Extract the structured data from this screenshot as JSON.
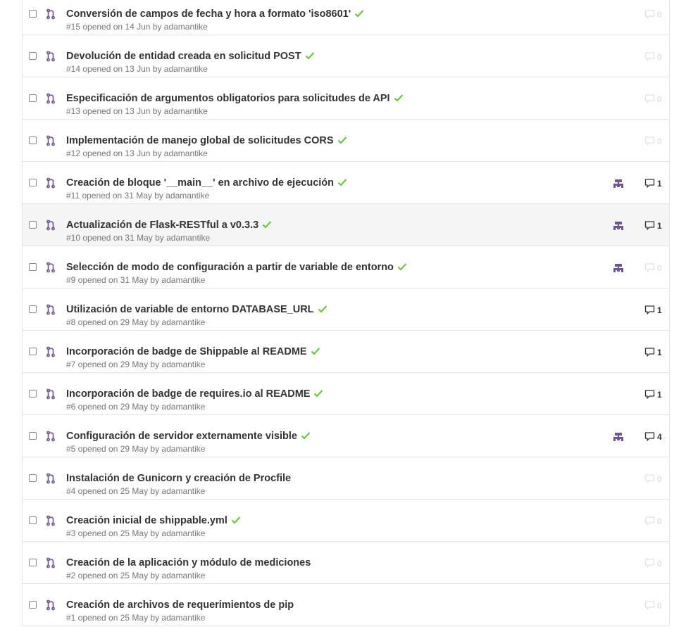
{
  "colors": {
    "pr_icon": "#6e5494",
    "check": "#6cc644",
    "milestone": "#6e5494",
    "comment_active": "#333333",
    "comment_zero": "#e2e2e2",
    "title": "#333333",
    "meta": "#767676"
  },
  "icons": {
    "pr": "git-pull-request-icon",
    "check": "check-icon",
    "milestone": "milestone-icon",
    "comment": "comment-icon"
  },
  "pull_requests": [
    {
      "title": "Conversión de campos de fecha y hora a formato 'iso8601'",
      "meta": "#15 opened on 14 Jun by adamantike",
      "check": true,
      "milestone": false,
      "comments": "0"
    },
    {
      "title": "Devolución de entidad creada en solicitud POST",
      "meta": "#14 opened on 13 Jun by adamantike",
      "check": true,
      "milestone": false,
      "comments": "0"
    },
    {
      "title": "Especificación de argumentos obligatorios para solicitudes de API",
      "meta": "#13 opened on 13 Jun by adamantike",
      "check": true,
      "milestone": false,
      "comments": "0"
    },
    {
      "title": "Implementación de manejo global de solicitudes CORS",
      "meta": "#12 opened on 13 Jun by adamantike",
      "check": true,
      "milestone": false,
      "comments": "0"
    },
    {
      "title": "Creación de bloque '__main__' en archivo de ejecución",
      "meta": "#11 opened on 31 May by adamantike",
      "check": true,
      "milestone": true,
      "comments": "1"
    },
    {
      "title": "Actualización de Flask-RESTful a v0.3.3",
      "meta": "#10 opened on 31 May by adamantike",
      "check": true,
      "milestone": true,
      "comments": "1",
      "highlight": true
    },
    {
      "title": "Selección de modo de configuración a partir de variable de entorno",
      "meta": "#9 opened on 31 May by adamantike",
      "check": true,
      "milestone": true,
      "comments": "0"
    },
    {
      "title": "Utilización de variable de entorno DATABASE_URL",
      "meta": "#8 opened on 29 May by adamantike",
      "check": true,
      "milestone": false,
      "comments": "1"
    },
    {
      "title": "Incorporación de badge de Shippable al README",
      "meta": "#7 opened on 29 May by adamantike",
      "check": true,
      "milestone": false,
      "comments": "1"
    },
    {
      "title": "Incorporación de badge de requires.io al README",
      "meta": "#6 opened on 29 May by adamantike",
      "check": true,
      "milestone": false,
      "comments": "1"
    },
    {
      "title": "Configuración de servidor externamente visible",
      "meta": "#5 opened on 29 May by adamantike",
      "check": true,
      "milestone": true,
      "comments": "4"
    },
    {
      "title": "Instalación de Gunicorn y creación de Procfile",
      "meta": "#4 opened on 25 May by adamantike",
      "check": false,
      "milestone": false,
      "comments": "0"
    },
    {
      "title": "Creación inicial de shippable.yml",
      "meta": "#3 opened on 25 May by adamantike",
      "check": true,
      "milestone": false,
      "comments": "0"
    },
    {
      "title": "Creación de la aplicación y módulo de mediciones",
      "meta": "#2 opened on 25 May by adamantike",
      "check": false,
      "milestone": false,
      "comments": "0"
    },
    {
      "title": "Creación de archivos de requerimientos de pip",
      "meta": "#1 opened on 25 May by adamantike",
      "check": false,
      "milestone": false,
      "comments": "0"
    }
  ]
}
